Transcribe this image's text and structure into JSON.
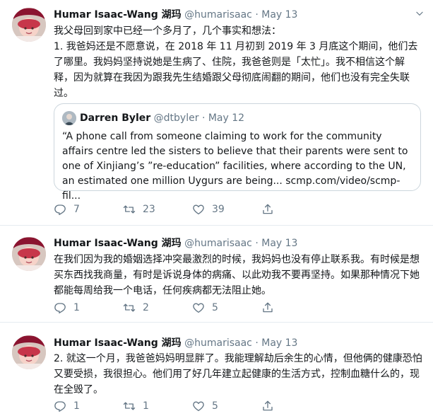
{
  "tweets": [
    {
      "name": "Humar Isaac-Wang 湖玛",
      "handle": "@humarisaac",
      "dot": "·",
      "date": "May 13",
      "text": "我父母回到家中已经一个多月了，几个事实和想法：\n1. 我爸妈还是不愿意说，在 2018 年 11 月初到 2019 年 3 月底这个期间，他们去了哪里。我妈妈坚持说她是生病了、住院，我爸爸则是「太忙」。我不相信这个解释，因为就算在我因为跟我先生结婚跟父母彻底闹翻的期间，他们也没有完全失联过。",
      "quote": {
        "name": "Darren Byler",
        "handle": "@dtbyler",
        "dot": "·",
        "date": "May 12",
        "text": "“A phone call from someone claiming to work for the community affairs centre led the sisters to believe that their parents were sent to one of Xinjiang’s ”re-education” facilities, where according to the UN, an estimated one million Uygurs are being... scmp.com/video/scmp-fil..."
      },
      "replies": "7",
      "retweets": "23",
      "likes": "39"
    },
    {
      "name": "Humar Isaac-Wang 湖玛",
      "handle": "@humarisaac",
      "dot": "·",
      "date": "May 13",
      "text": "在我们因为我的婚姻选择冲突最激烈的时候，我妈妈也没有停止联系我。有时候是想买东西找我商量，有时是诉说身体的病痛、以此劝我不要再坚持。如果那种情况下她都能每周给我一个电话，任何疾病都无法阻止她。",
      "replies": "1",
      "retweets": "2",
      "likes": "5"
    },
    {
      "name": "Humar Isaac-Wang 湖玛",
      "handle": "@humarisaac",
      "dot": "·",
      "date": "May 13",
      "text": "2. 就这一个月，我爸爸妈妈明显胖了。我能理解劫后余生的心情，但他俩的健康恐怕又要受损，我很担心。他们用了好几年建立起健康的生活方式，控制血糖什么的，现在全毁了。",
      "replies": "1",
      "retweets": "1",
      "likes": "5"
    }
  ]
}
